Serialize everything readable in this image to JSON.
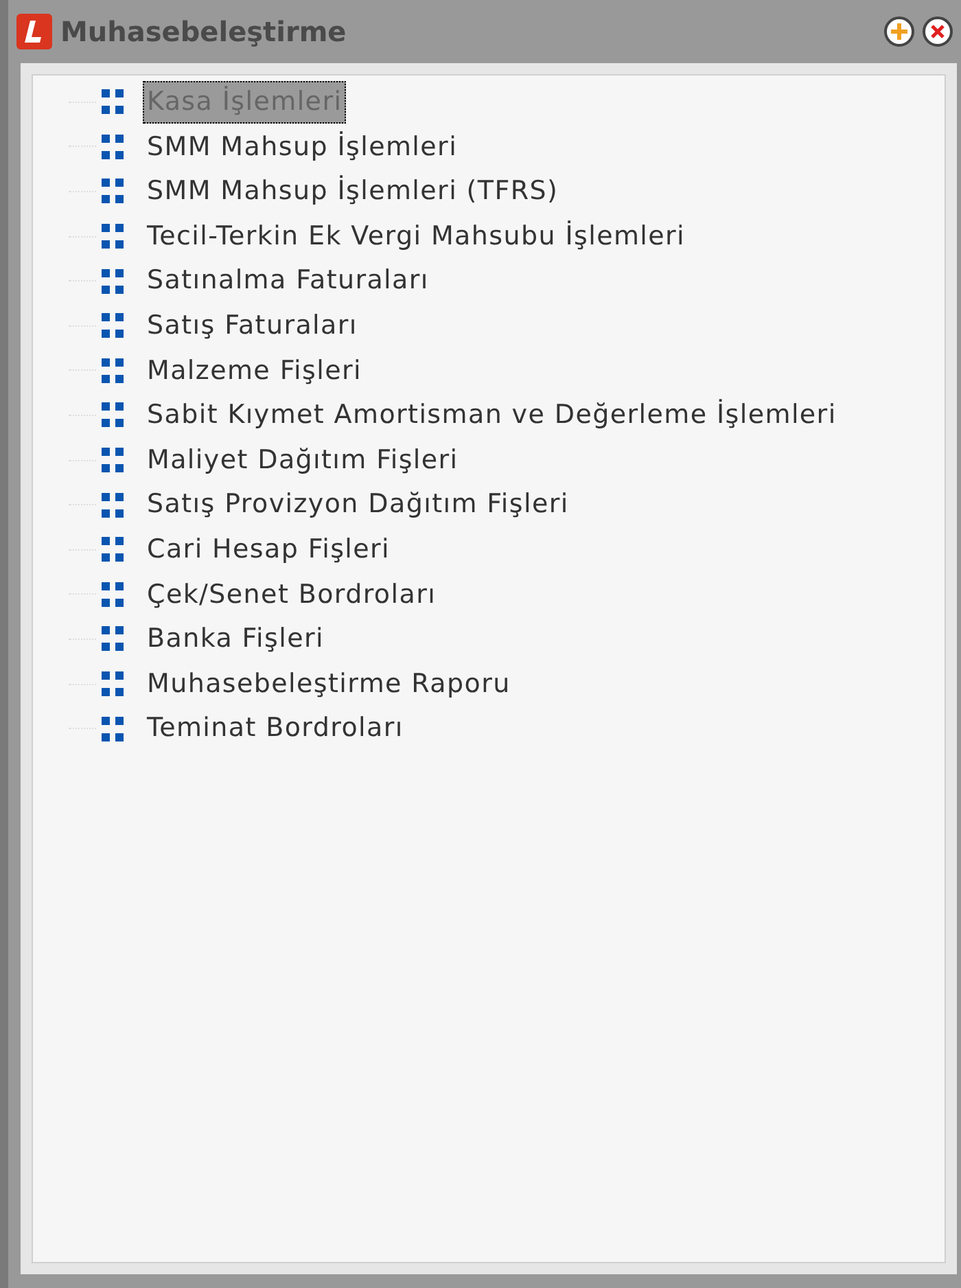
{
  "window": {
    "title": "Muhasebeleştirme"
  },
  "tree": {
    "items": [
      {
        "label": "Kasa İşlemleri",
        "selected": true
      },
      {
        "label": "SMM Mahsup İşlemleri",
        "selected": false
      },
      {
        "label": "SMM Mahsup İşlemleri (TFRS)",
        "selected": false
      },
      {
        "label": "Tecil-Terkin Ek Vergi Mahsubu İşlemleri",
        "selected": false
      },
      {
        "label": "Satınalma Faturaları",
        "selected": false
      },
      {
        "label": "Satış Faturaları",
        "selected": false
      },
      {
        "label": "Malzeme Fişleri",
        "selected": false
      },
      {
        "label": "Sabit Kıymet Amortisman ve Değerleme İşlemleri",
        "selected": false
      },
      {
        "label": "Maliyet Dağıtım Fişleri",
        "selected": false
      },
      {
        "label": "Satış Provizyon Dağıtım Fişleri",
        "selected": false
      },
      {
        "label": "Cari Hesap Fişleri",
        "selected": false
      },
      {
        "label": "Çek/Senet Bordroları",
        "selected": false
      },
      {
        "label": "Banka Fişleri",
        "selected": false
      },
      {
        "label": "Muhasebeleştirme Raporu",
        "selected": false
      },
      {
        "label": "Teminat Bordroları",
        "selected": false
      }
    ]
  }
}
